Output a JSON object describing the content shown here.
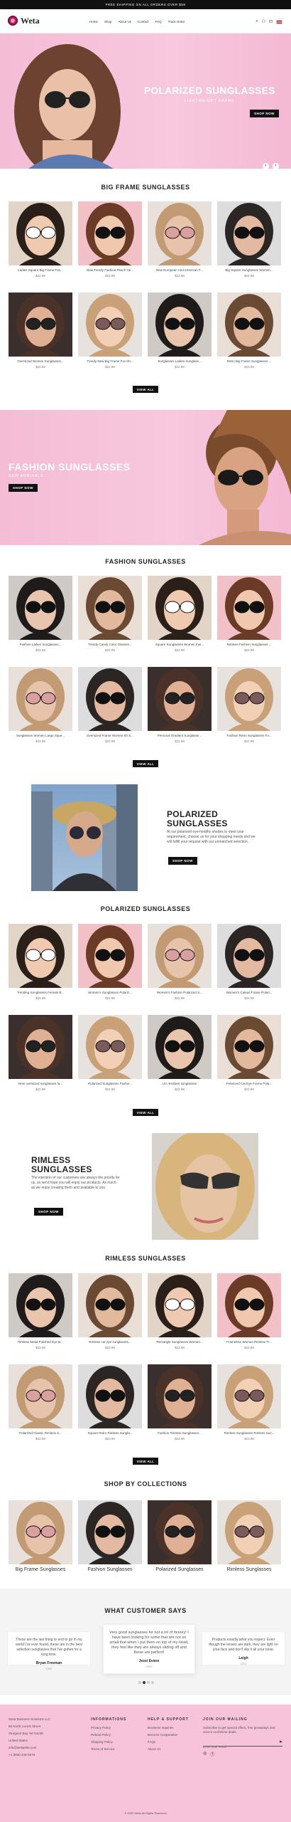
{
  "topbar": {
    "text": "FREE SHIPPING ON ALL ORDERS OVER $59"
  },
  "header": {
    "brand": "Weta",
    "nav": [
      "Home",
      "Shop",
      "About Us",
      "Contact",
      "FAQ",
      "Track Order"
    ]
  },
  "hero1": {
    "title": "POLARIZED SUNGLASSES",
    "subtitle": "LIGHTWEIGHT FRAME",
    "button": "SHOP NOW",
    "arrows": [
      "‹",
      "›"
    ]
  },
  "big_frame": {
    "title": "BIG FRAME SUNGLASSES",
    "view_all": "VIEW ALL",
    "products": [
      {
        "name": "Ladies Square Big Frame Fas...",
        "price": "$22.99"
      },
      {
        "name": "New Trendy Fashion Peach He...",
        "price": "$22.99"
      },
      {
        "name": "New European And American F...",
        "price": "$22.99"
      },
      {
        "name": "Big Square Sunglasses Women...",
        "price": "$22.99"
      },
      {
        "name": "Oversized Women Sunglasses...",
        "price": "$22.99"
      },
      {
        "name": "Trendy New Big Frame Fox Sh...",
        "price": "$22.99"
      },
      {
        "name": "Sunglasses Ladies Sunglass...",
        "price": "$22.99"
      },
      {
        "name": "Retro Big Frame Sunglasses ...",
        "price": "$22.99"
      }
    ]
  },
  "hero2": {
    "title": "FASHION SUNGLASSES",
    "subtitle": "NEW ARRIVALS",
    "button": "SHOP NOW"
  },
  "fashion": {
    "title": "FASHION SUNGLASSES",
    "view_all": "VIEW ALL",
    "products": [
      {
        "name": "Fashion Ladies Sunglasses...",
        "price": "$22.99"
      },
      {
        "name": "Trendy Candy Color Glasses...",
        "price": "$22.99"
      },
      {
        "name": "Square Sunglasses Women Fas...",
        "price": "$22.99"
      },
      {
        "name": "Rimless Fashion Sunglasses ...",
        "price": "$22.99"
      },
      {
        "name": "Sunglasses Women Large Sque...",
        "price": "$22.99"
      },
      {
        "name": "Oversized Frame Women Sh S...",
        "price": "$22.99"
      },
      {
        "name": "Personal Gradient Sunglasse...",
        "price": "$22.99"
      },
      {
        "name": "Fashion Retro Sunglasses Fo...",
        "price": "$22.99"
      }
    ]
  },
  "polarized_split": {
    "title": "POLARIZED SUNGLASSES",
    "text": "At our polarized eye-healthy shades to meet your requirement, choose us for your shopping needs and we will fulfill your request with our unmatched selection.",
    "button": "SHOP NOW"
  },
  "polarized": {
    "title": "POLARIZED SUNGLASSES",
    "view_all": "VIEW ALL",
    "products": [
      {
        "name": "Trending Sunglasses Female B...",
        "price": "$22.99"
      },
      {
        "name": "Women's Sunglasses Polariz...",
        "price": "$22.99"
      },
      {
        "name": "Women's Fashion Polarized S...",
        "price": "$22.99"
      },
      {
        "name": "Women's Cateye Frame Polari...",
        "price": "$22.99"
      },
      {
        "name": "New oversized sunglasses fa...",
        "price": "$22.99"
      },
      {
        "name": "Polarized Sunglasses Fashio...",
        "price": "$22.99"
      },
      {
        "name": "UV resistant sunglasses",
        "price": "$22.99"
      },
      {
        "name": "Polarized Cat Eye Frame Pola...",
        "price": "$22.99"
      }
    ]
  },
  "rimless_split": {
    "title": "RIMLESS SUNGLASSES",
    "text": "The intention of our customers are always the priority for us, so we'd hope you will enjoy our products. As much as we enjoy creating them and available to you.",
    "button": "SHOP NOW"
  },
  "rimless": {
    "title": "RIMLESS SUNGLASSES",
    "view_all": "VIEW ALL",
    "products": [
      {
        "name": "Rimless Metal Polished Eye B...",
        "price": "$22.99"
      },
      {
        "name": "Rimless cat eye sunglasses...",
        "price": "$22.99"
      },
      {
        "name": "Rectangle Sunglasses Women...",
        "price": "$22.99"
      },
      {
        "name": "Frameless Women Rimless Tr...",
        "price": "$22.99"
      },
      {
        "name": "Polarized Classic Rimless S...",
        "price": "$22.99"
      },
      {
        "name": "Square Retro Rimless Sungla...",
        "price": "$22.99"
      },
      {
        "name": "Fashion Rimless Sunglasses...",
        "price": "$22.99"
      },
      {
        "name": "Rimless Sunglasses Rimless Sun...",
        "price": "$22.99"
      }
    ]
  },
  "collections": {
    "title": "SHOP BY COLLECTIONS",
    "items": [
      "Big Frame Sunglasses",
      "Fashion Sunglasses",
      "Polarized Sunglasses",
      "Rimless Sunglasses"
    ]
  },
  "testimonials": {
    "title": "WHAT CUSTOMER SAYS",
    "items": [
      {
        "quote": "These are the last thing to end to go in my world I've ever found, these are in the best selection sunglasses that I've gotten for a long time.",
        "author": "Bryan Freeman",
        "role": "CEO"
      },
      {
        "quote": "Very good sunglasses for not a lot of money! I have been looking for some that are not so small that when I put them on top of my head, they feel like they are always sliding off and these are perfect!",
        "author": "Jessi Evans",
        "role": "CEO"
      },
      {
        "quote": "Products exactly what you expect. Even though the lenses are dark, they are light on your face and don't slip it all your nose.",
        "author": "Leigh",
        "role": "CEO"
      }
    ]
  },
  "footer": {
    "address": [
      "Weta Business Solutions LLC",
      "85 North Locust Street",
      "Sturgeon Bay, WI 54235",
      "United States",
      "info@wetaelite.com",
      "+1 (555) 234-5678"
    ],
    "col1": {
      "h": "INFORMATIONS",
      "links": [
        "Privacy Policy",
        "Refund Policy",
        "Shipping Policy",
        "Terms of Service"
      ]
    },
    "col2": {
      "h": "HELP & SUPPORT",
      "links": [
        "Business Inquiries",
        "Become Cooperative",
        "FAQs",
        "About Us"
      ]
    },
    "col3": {
      "h": "JOIN OUR MAILING",
      "text": "Subscribe to get special offers, free giveaways and once-in-a-lifetime deals.",
      "placeholder": "Enter your email"
    },
    "copyright": "© 2023 Weta All Rights Reserved"
  },
  "colors": {
    "pink": "#f7c3da",
    "black": "#111111"
  }
}
